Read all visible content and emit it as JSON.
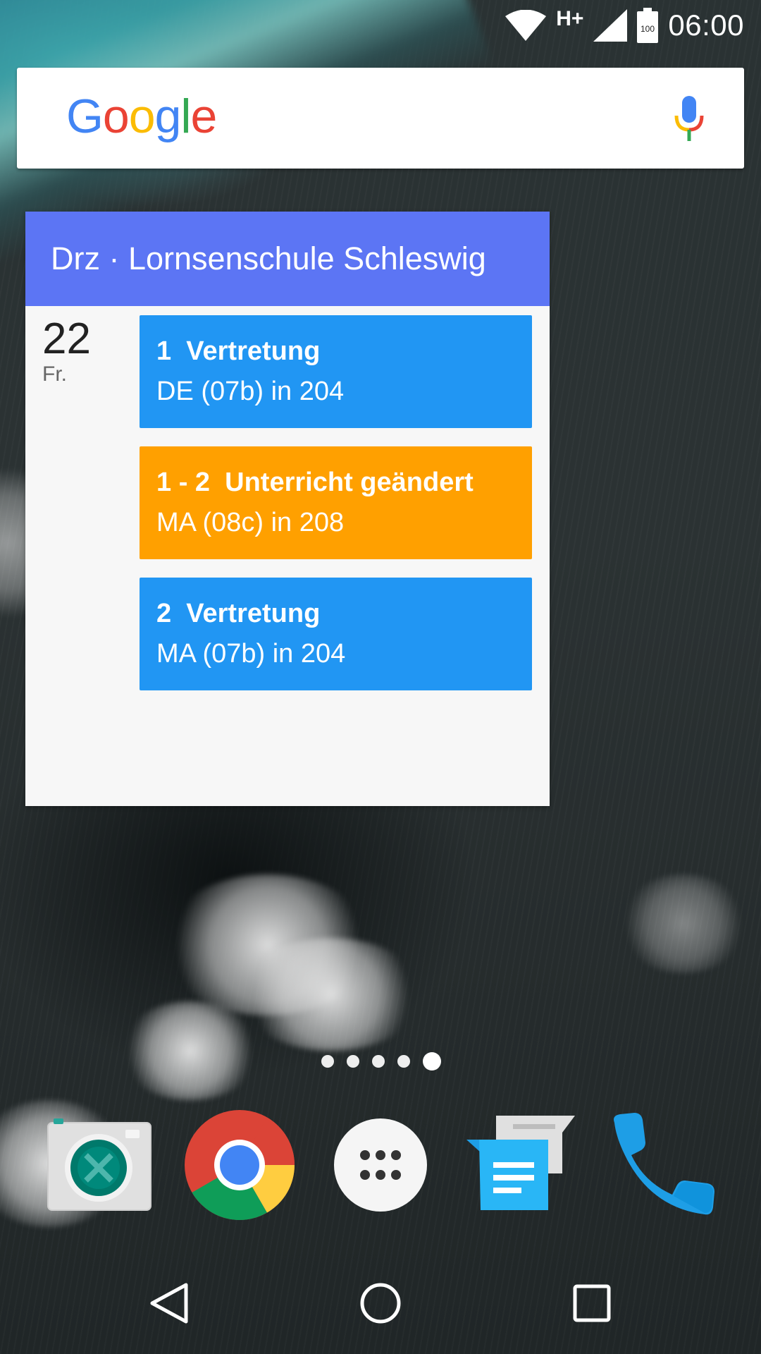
{
  "status_bar": {
    "network_type": "H+",
    "battery_level": "100",
    "time": "06:00",
    "icons": [
      "wifi-icon",
      "signal-icon",
      "battery-icon"
    ]
  },
  "search_bar": {
    "logo_text": "Google",
    "logo_colors": [
      "#4285F4",
      "#EA4335",
      "#FBBC05",
      "#4285F4",
      "#34A853",
      "#EA4335"
    ],
    "mic_icon": "mic-icon"
  },
  "widget": {
    "title": "Drz · Lornsenschule Schleswig",
    "header_color": "#5c75f4",
    "day_number": "22",
    "day_name": "Fr.",
    "events": [
      {
        "title": "1  Vertretung",
        "detail": "DE (07b) in 204",
        "color": "#2196f3"
      },
      {
        "title": "1 - 2  Unterricht geändert",
        "detail": "MA (08c) in 208",
        "color": "#ffa000"
      },
      {
        "title": "2  Vertretung",
        "detail": "MA (07b) in 204",
        "color": "#2196f3"
      }
    ]
  },
  "page_indicator": {
    "count": 5,
    "active_index": 4
  },
  "dock": {
    "apps": [
      "camera-icon",
      "chrome-icon",
      "app-drawer-icon",
      "messenger-icon",
      "phone-icon"
    ]
  },
  "nav_bar": {
    "buttons": [
      "back-icon",
      "home-icon",
      "recents-icon"
    ]
  }
}
